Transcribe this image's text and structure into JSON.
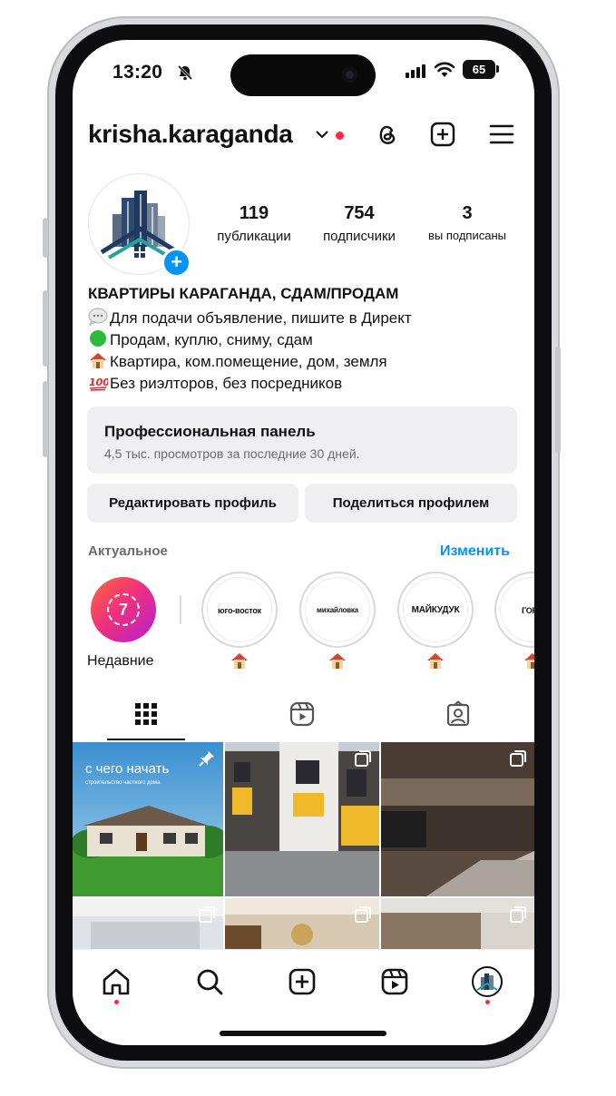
{
  "status_bar": {
    "time": "13:20",
    "battery": "65"
  },
  "header": {
    "username": "krisha.karaganda"
  },
  "profile": {
    "stats": [
      {
        "value": "119",
        "label": "публикации"
      },
      {
        "value": "754",
        "label": "подписчики"
      },
      {
        "value": "3",
        "label": "вы подписаны"
      }
    ],
    "bio_name": "КВАРТИРЫ КАРАГАНДА, СДАМ/ПРОДАМ",
    "bio_lines": [
      "Для подачи объявление, пишите в Директ",
      "Продам, куплю, сниму, сдам",
      "Квартира, ком.помещение, дом, земля",
      "Без риэлторов, без посредников"
    ]
  },
  "pro_panel": {
    "title": "Профессиональная панель",
    "subtitle": "4,5 тыс. просмотров за последние 30 дней."
  },
  "buttons": {
    "edit": "Редактировать профиль",
    "share": "Поделиться профилем"
  },
  "highlights": {
    "title": "Актуальное",
    "edit_label": "Изменить",
    "recent_label": "Недавние",
    "recent_count": "7",
    "items": [
      "юго-восток",
      "михайловка",
      "майкудук",
      "горо"
    ]
  },
  "post_overlay": {
    "line1": "с чего начать",
    "line2": "строительство частного дома"
  },
  "colors": {
    "accent": "#0095f6",
    "notification": "#ff2a40",
    "panel": "#efeff1"
  },
  "icons": {
    "header": [
      "threads-icon",
      "plus-square-icon",
      "menu-icon"
    ],
    "tabs": [
      "grid-icon",
      "reels-icon",
      "tagged-icon"
    ],
    "nav": [
      "home-icon",
      "search-icon",
      "create-icon",
      "reels-icon",
      "profile-avatar-icon"
    ]
  }
}
